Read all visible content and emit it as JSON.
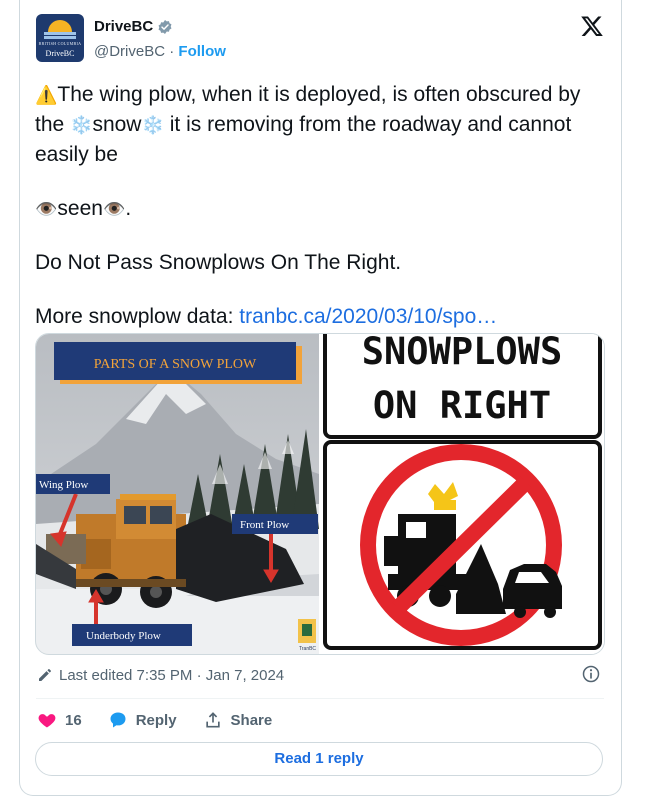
{
  "author": {
    "avatar_line1": "BRITISH COLUMBIA",
    "avatar_line2": "DriveBC",
    "name": "DriveBC",
    "handle": "@DriveBC",
    "separator": "·",
    "follow_label": "Follow",
    "verified_icon": "verified-badge-icon"
  },
  "platform_icon": "x-logo-icon",
  "tweet": {
    "line1_text": "The wing plow, when it is deployed, is often obscured by the ",
    "snow_word": "snow",
    "line1_rest": " it is removing from the roadway and cannot easily be",
    "seen_word": "seen",
    "seen_after": ".",
    "paragraph3": "Do Not Pass Snowplows On The Right.",
    "paragraph4_prefix": "More snowplow data: ",
    "paragraph4_link": "tranbc.ca/2020/03/10/spo…",
    "emoji_warning": "⚠️",
    "emoji_snow": "❄️",
    "emoji_eye": "👁️"
  },
  "media": {
    "left_image": {
      "title": "PARTS OF A SNOW PLOW",
      "label_wing": "Wing Plow",
      "label_front": "Front Plow",
      "label_underbody": "Underbody Plow",
      "corner_logo": "TranBC"
    },
    "right_image": {
      "sign_line1": "SNOWPLOWS",
      "sign_line2": "ON RIGHT"
    }
  },
  "meta": {
    "edit_icon": "pencil-icon",
    "edited_text": "Last edited 7:35 PM · Jan 7, 2024",
    "info_icon": "info-icon"
  },
  "actions": {
    "like_count": "16",
    "reply_label": "Reply",
    "share_label": "Share"
  },
  "read_replies_label": "Read 1 reply",
  "colors": {
    "accent": "#1d9bf0",
    "like": "#f91880",
    "link": "#1d6ee0",
    "text_secondary": "#536471",
    "border": "#cfd9de"
  }
}
